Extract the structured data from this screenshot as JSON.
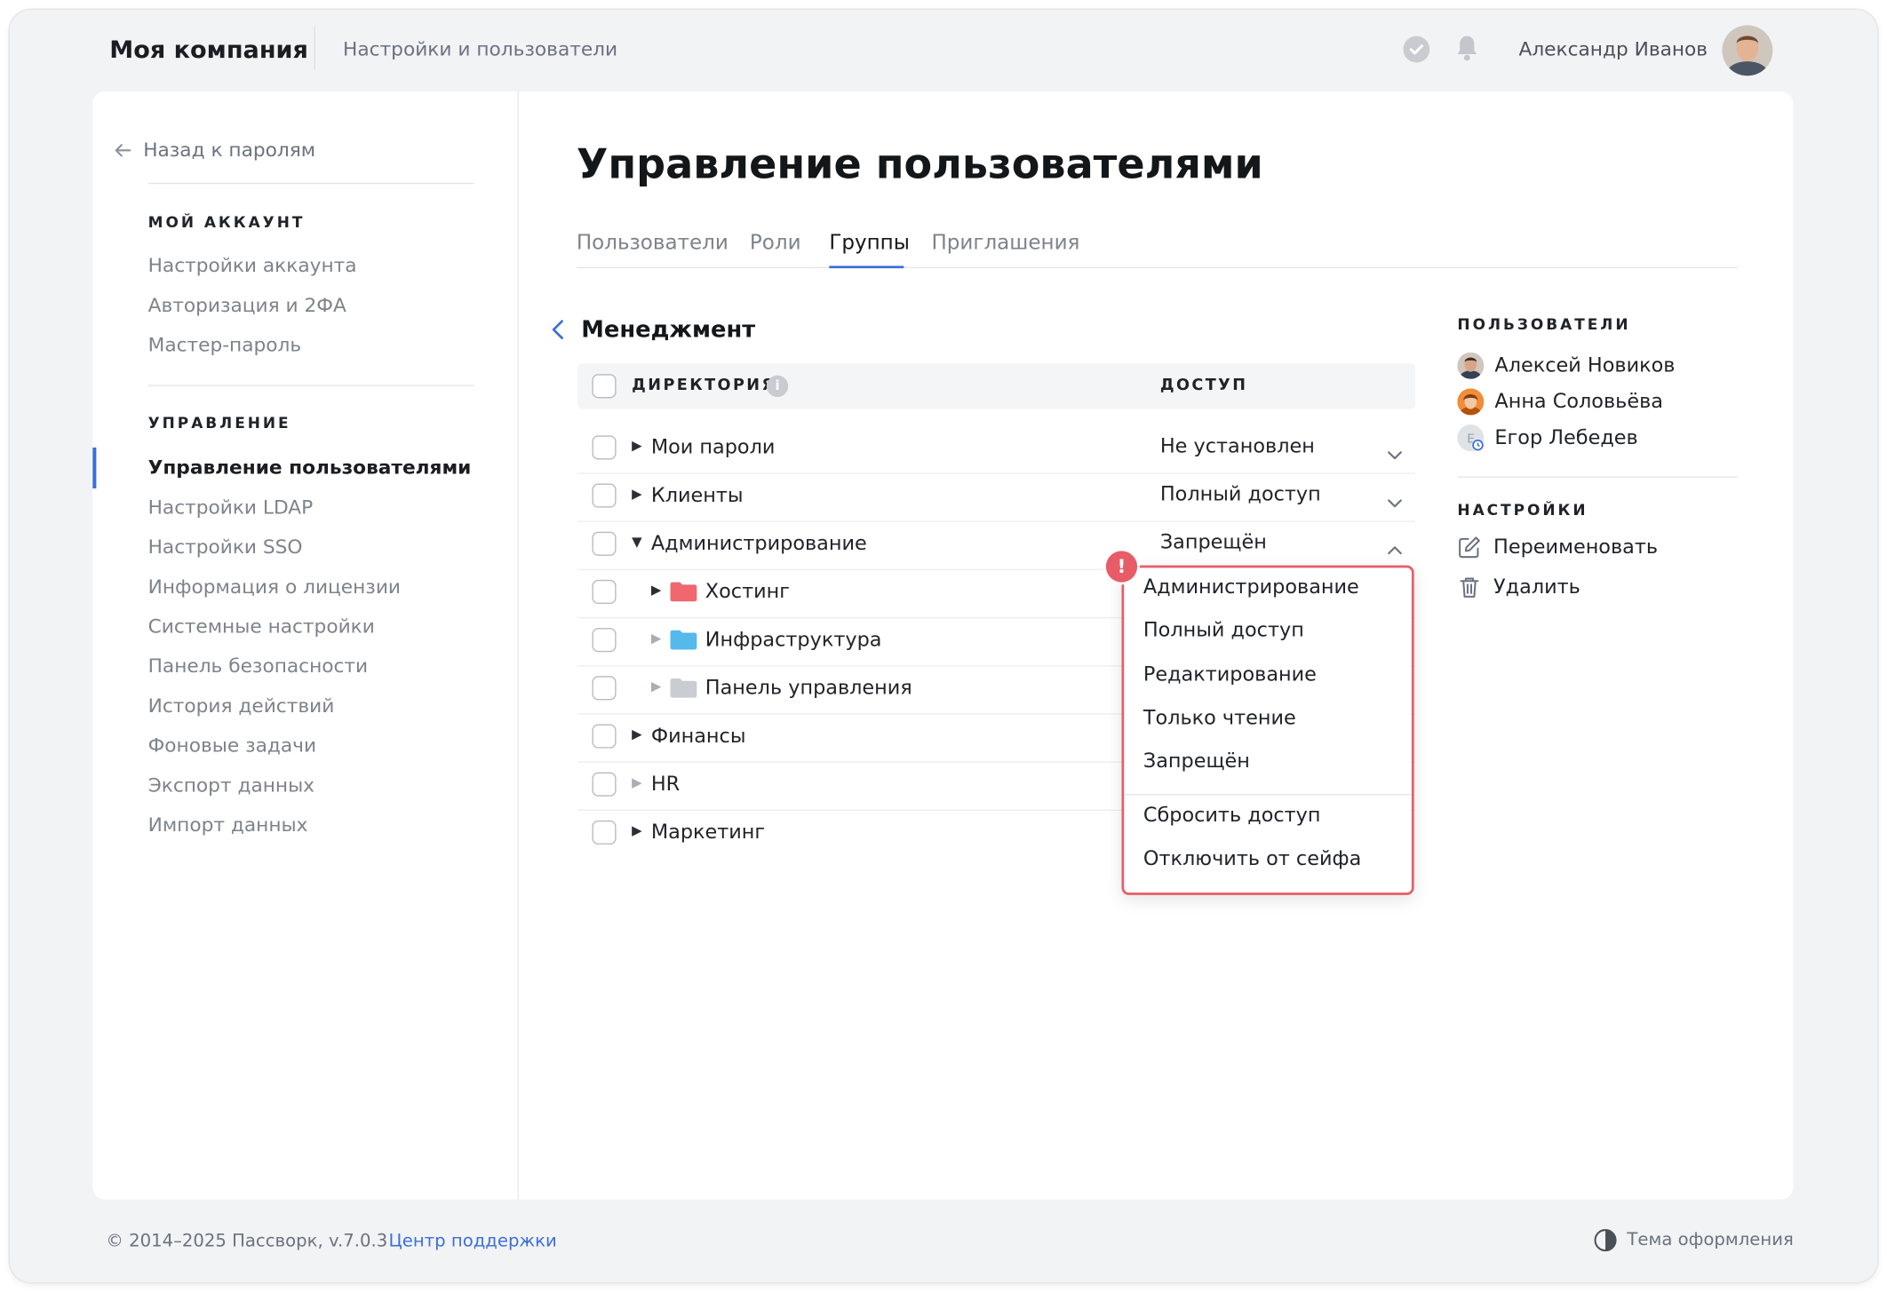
{
  "header": {
    "brand": "Моя компания",
    "section": "Настройки и пользователи",
    "user_name": "Александр Иванов"
  },
  "sidebar": {
    "back_label": "Назад к паролям",
    "account_title": "МОЙ АККАУНТ",
    "account_items": [
      "Настройки аккаунта",
      "Авторизация и 2ФА",
      "Мастер-пароль"
    ],
    "manage_title": "УПРАВЛЕНИЕ",
    "manage_items": [
      "Управление пользователями",
      "Настройки LDAP",
      "Настройки SSO",
      "Информация о лицензии",
      "Системные настройки",
      "Панель безопасности",
      "История действий",
      "Фоновые задачи",
      "Экспорт данных",
      "Импорт данных"
    ],
    "active_item": "Управление пользователями"
  },
  "main": {
    "title": "Управление пользователями",
    "tabs": [
      "Пользователи",
      "Роли",
      "Группы",
      "Приглашения"
    ],
    "active_tab": "Группы",
    "group_name": "Менеджмент",
    "table": {
      "col_directory": "ДИРЕКТОРИЯ",
      "col_access": "ДОСТУП",
      "rows": [
        {
          "name": "Мои пароли",
          "access": "Не установлен",
          "expanded": false,
          "level": 0
        },
        {
          "name": "Клиенты",
          "access": "Полный доступ",
          "expanded": false,
          "level": 0
        },
        {
          "name": "Администрирование",
          "access": "Запрещён",
          "expanded": true,
          "level": 0
        },
        {
          "name": "Хостинг",
          "level": 1,
          "folder_color": "#f0676f"
        },
        {
          "name": "Инфраструктура",
          "level": 1,
          "folder_color": "#55b9ec"
        },
        {
          "name": "Панель управления",
          "level": 1,
          "folder_color": "#c9ccd1"
        },
        {
          "name": "Финансы",
          "level": 0
        },
        {
          "name": "HR",
          "level": 0
        },
        {
          "name": "Маркетинг",
          "level": 0
        }
      ]
    },
    "access_menu": {
      "options": [
        "Администрирование",
        "Полный доступ",
        "Редактирование",
        "Только чтение",
        "Запрещён"
      ],
      "actions": [
        "Сбросить доступ",
        "Отключить от сейфа"
      ]
    }
  },
  "right_panel": {
    "users_title": "ПОЛЬЗОВАТЕЛИ",
    "users": [
      "Алексей Новиков",
      "Анна Соловьёва",
      "Егор Лебедев"
    ],
    "settings_title": "НАСТРОЙКИ",
    "rename_label": "Переименовать",
    "delete_label": "Удалить"
  },
  "footer": {
    "copyright": "© 2014–2025 Пассворк, v.7.0.3",
    "support": "Центр поддержки",
    "theme": "Тема оформления"
  },
  "colors": {
    "accent": "#3b6fd8",
    "alert": "#e85c67"
  }
}
